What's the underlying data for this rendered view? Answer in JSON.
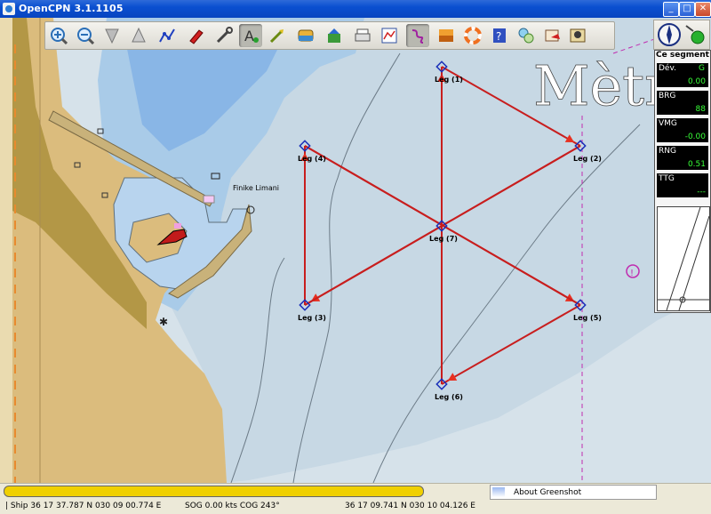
{
  "window": {
    "title": "OpenCPN 3.1.1105",
    "min": "_",
    "max": "□",
    "close": "✕"
  },
  "toolbar": {
    "tools": [
      {
        "name": "zoom-in-icon",
        "active": false
      },
      {
        "name": "zoom-out-icon",
        "active": false
      },
      {
        "name": "scale-in-icon",
        "active": false
      },
      {
        "name": "scale-out-icon",
        "active": false
      },
      {
        "name": "create-route-icon",
        "active": false
      },
      {
        "name": "auto-follow-icon",
        "active": false
      },
      {
        "name": "settings-icon",
        "active": false
      },
      {
        "name": "text-icon",
        "active": true
      },
      {
        "name": "current-icon",
        "active": false
      },
      {
        "name": "tides-icon",
        "active": false
      },
      {
        "name": "chart-quilt-icon",
        "active": false
      },
      {
        "name": "print-icon",
        "active": false
      },
      {
        "name": "route-manager-icon",
        "active": false
      },
      {
        "name": "track-icon",
        "active": true
      },
      {
        "name": "color-scheme-icon",
        "active": false
      },
      {
        "name": "mob-icon",
        "active": false
      },
      {
        "name": "help-icon",
        "active": false
      },
      {
        "name": "plugin-icon",
        "active": false
      },
      {
        "name": "ais-icon",
        "active": false
      },
      {
        "name": "about-icon",
        "active": false
      }
    ]
  },
  "map": {
    "place_name": "Finike Limani",
    "watermark": "Mètr",
    "waypoints": [
      {
        "label": "Leg (1)"
      },
      {
        "label": "Leg (2)"
      },
      {
        "label": "Leg (3)"
      },
      {
        "label": "Leg (4)"
      },
      {
        "label": "Leg (5)"
      },
      {
        "label": "Leg (6)"
      },
      {
        "label": "Leg (7)"
      }
    ],
    "route_color": "#c81e1e",
    "waypoint_color": "#1a2fb8"
  },
  "dashboard": {
    "title": "Ce segment",
    "instruments": [
      {
        "caption": "Dév.",
        "caption2": "G",
        "value": "0.00"
      },
      {
        "caption": "BRG",
        "caption2": "",
        "value": "88"
      },
      {
        "caption": "VMG",
        "caption2": "",
        "value": "-0.00"
      },
      {
        "caption": "RNG",
        "caption2": "",
        "value": "0.51"
      },
      {
        "caption": "TTG",
        "caption2": "",
        "value": "---"
      }
    ]
  },
  "status": {
    "notification": "About Greenshot",
    "ship": "| Ship 36 17 37.787 N    030 09 00.774 E",
    "sog": "SOG 0.00 kts   COG 243°",
    "cursor": "36 17 09.741 N    030 10 04.126 E",
    "progress": 1.0
  }
}
